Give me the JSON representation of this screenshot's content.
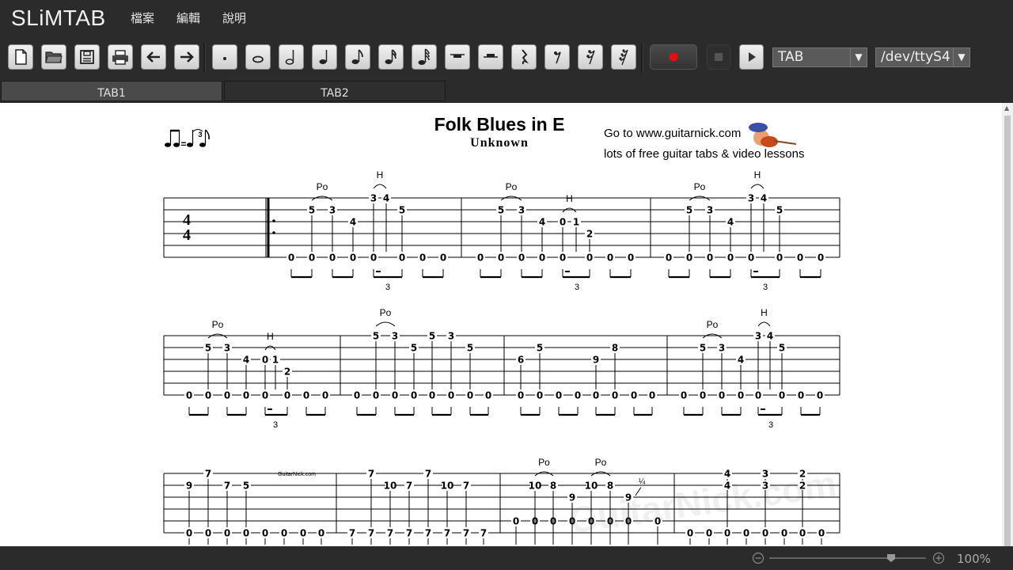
{
  "app": {
    "logo": "SLiMTAB"
  },
  "menu": {
    "items": [
      "檔案",
      "編輯",
      "說明"
    ]
  },
  "toolbar": {
    "file_buttons": [
      "new-file",
      "open-folder",
      "save",
      "print",
      "undo",
      "redo"
    ],
    "note_buttons": [
      "dot",
      "whole-note",
      "half-note",
      "quarter-note",
      "eighth-note",
      "sixteenth-note",
      "thirtysecond-note",
      "whole-rest",
      "half-rest",
      "quarter-rest",
      "eighth-rest",
      "sixteenth-rest",
      "thirtysecond-rest"
    ],
    "record_color": "#e01010",
    "view_mode": "TAB",
    "device": "/dev/ttyS4"
  },
  "tabs": [
    {
      "label": "TAB1",
      "active": true
    },
    {
      "label": "TAB2",
      "active": false
    }
  ],
  "song": {
    "title": "Folk Blues in E",
    "artist": "Unknown",
    "ad_prefix": "Go to ",
    "ad_link": "www.guitarnick.com",
    "ad_line2": "lots of free guitar tabs & video lessons",
    "time_signature": "4/4",
    "swing_triplet": "3",
    "watermark": "GuitarNick.com",
    "small_logo": "GuitarNick.com"
  },
  "statusbar": {
    "zoom": "100%"
  }
}
